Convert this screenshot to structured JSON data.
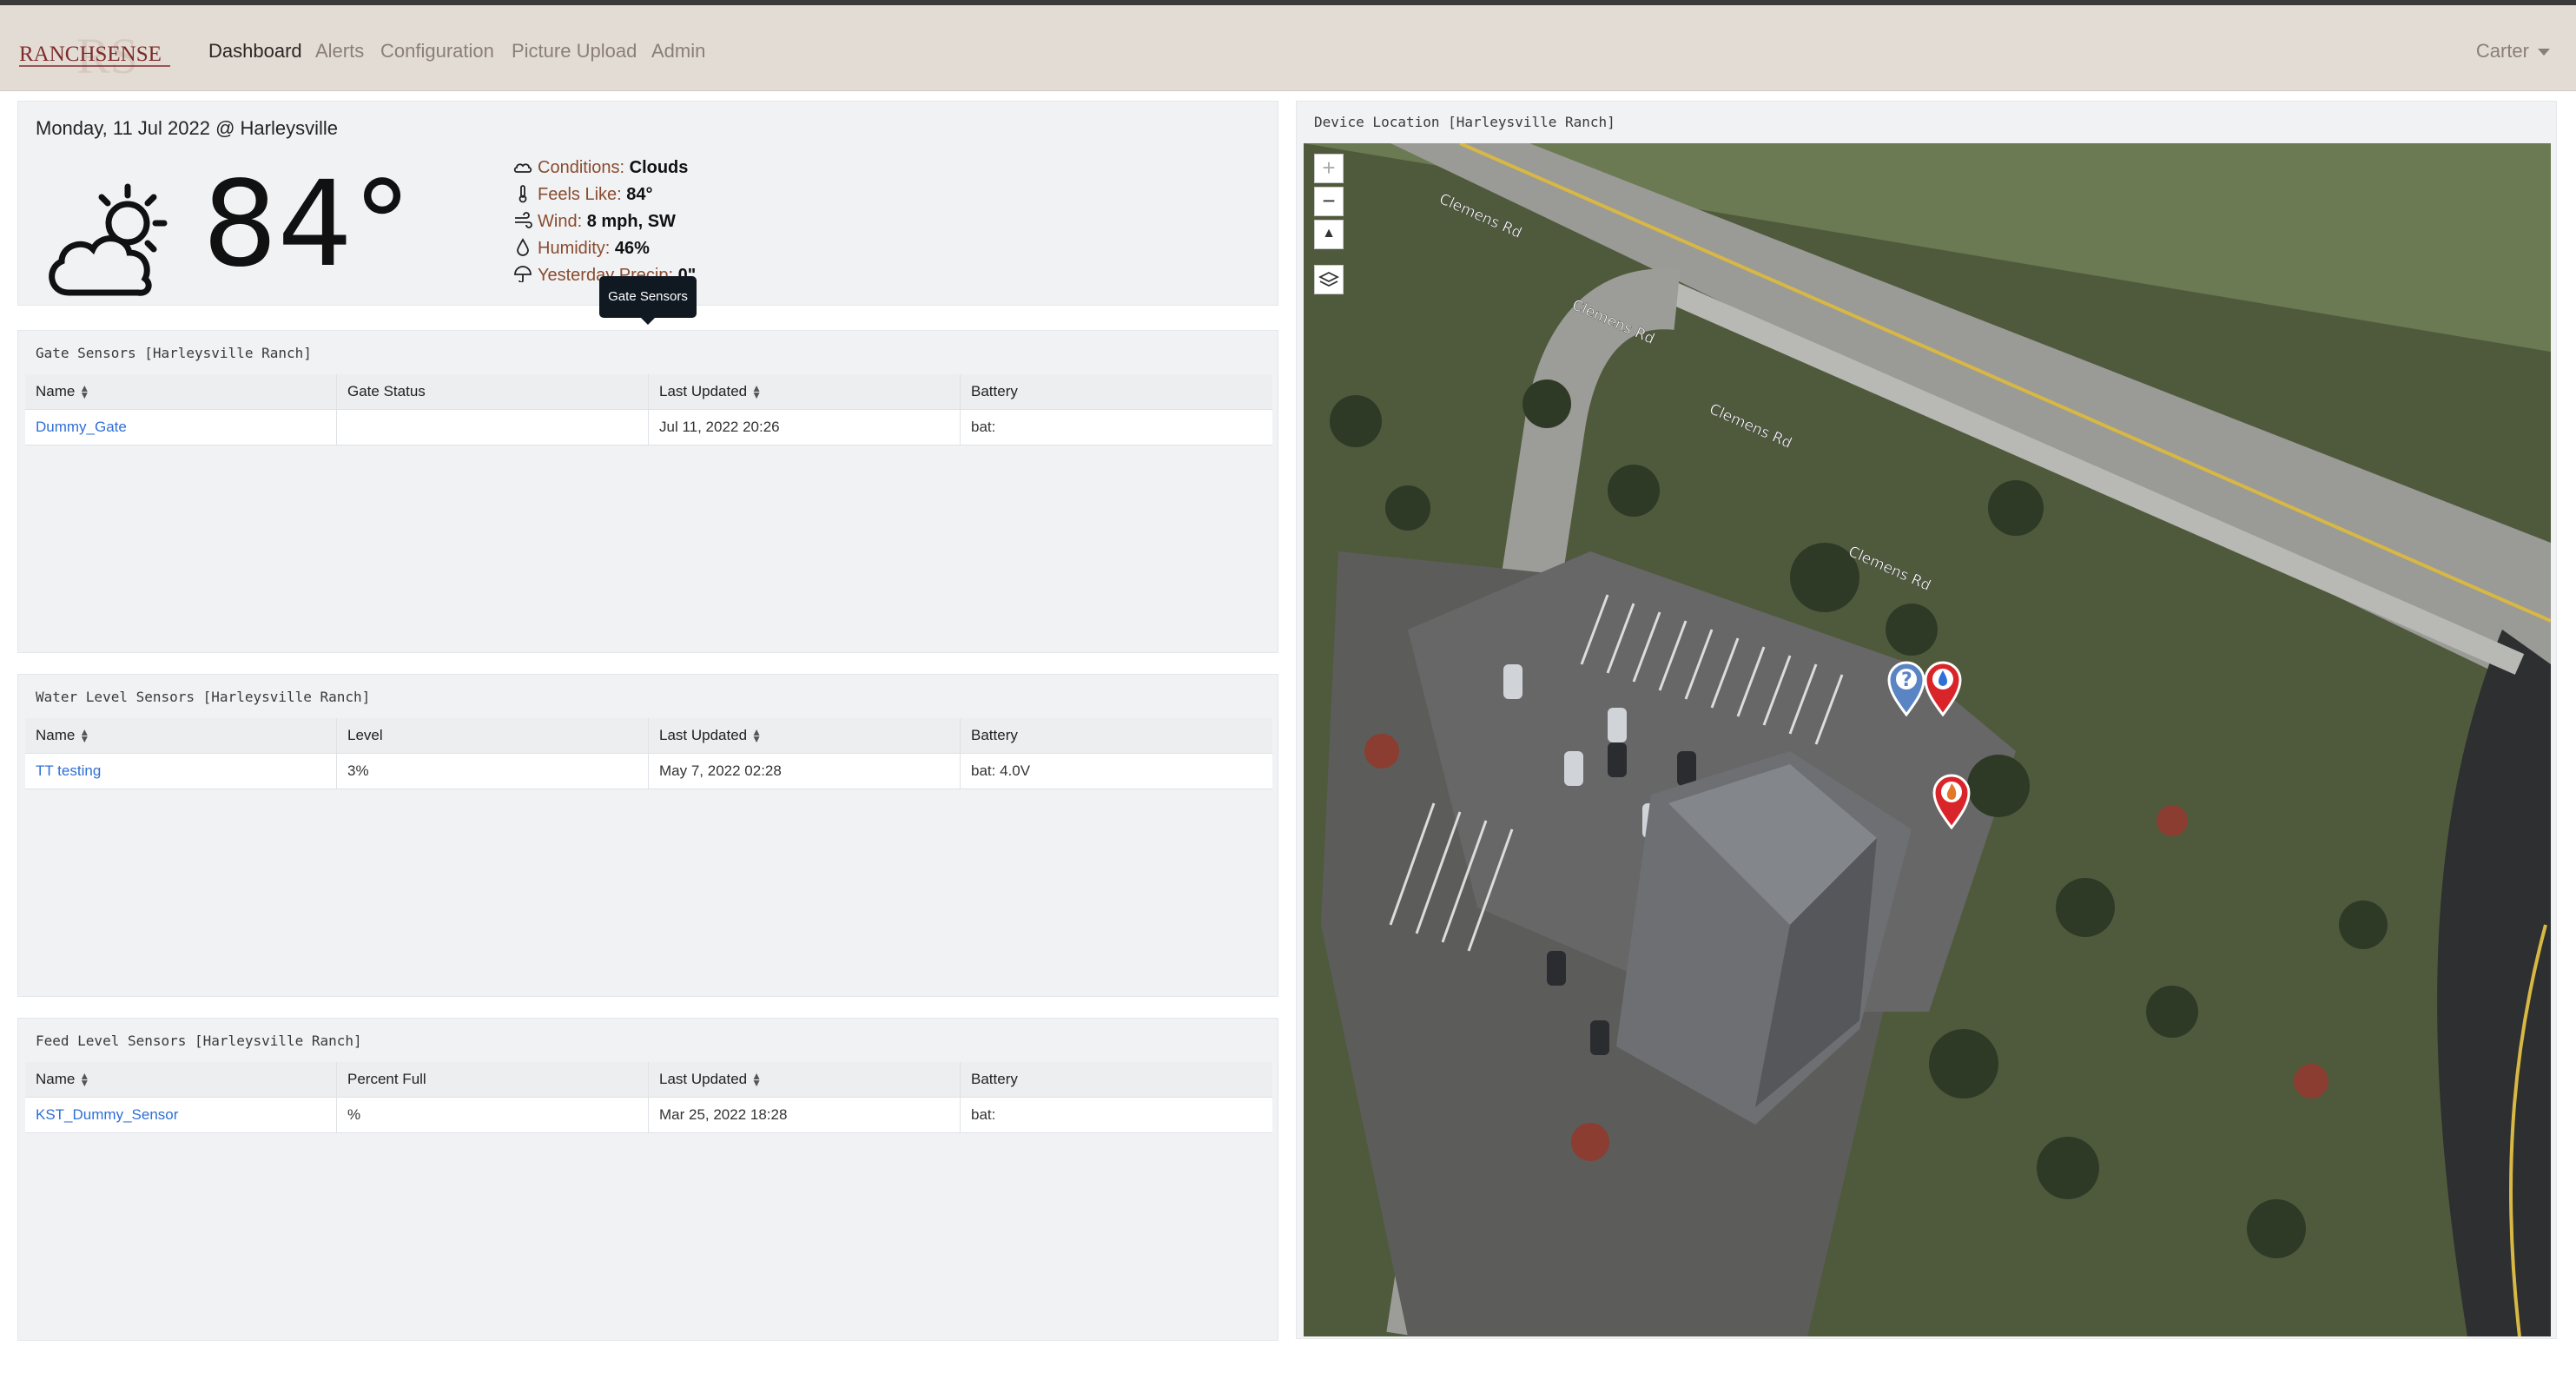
{
  "navbar": {
    "logo_text": "RANCHSENSE",
    "logo_monogram": "RS",
    "items": [
      {
        "label": "Dashboard",
        "active": true
      },
      {
        "label": "Alerts",
        "active": false
      },
      {
        "label": "Configuration",
        "active": false
      },
      {
        "label": "Picture Upload",
        "active": false
      },
      {
        "label": "Admin",
        "active": false
      }
    ],
    "user": "Carter",
    "colors": {
      "bar": "#e3dcd5",
      "active": "#2b2622",
      "inactive": "#8a7f78"
    }
  },
  "weather": {
    "date_location": "Monday, 11 Jul 2022 @ Harleysville",
    "icon": "partly-cloudy-sun-icon",
    "temperature": "84°",
    "rows": [
      {
        "icon": "cloud-icon",
        "label": "Conditions:",
        "value": "Clouds"
      },
      {
        "icon": "thermometer-icon",
        "label": "Feels Like:",
        "value": "84°"
      },
      {
        "icon": "wind-icon",
        "label": "Wind:",
        "value": "8 mph, SW"
      },
      {
        "icon": "droplet-icon",
        "label": "Humidity:",
        "value": "46%"
      },
      {
        "icon": "umbrella-icon",
        "label": "Yesterday Precip:",
        "value": "0\""
      }
    ],
    "tooltip": "Gate Sensors"
  },
  "gate_sensors": {
    "title": "Gate Sensors [Harleysville Ranch]",
    "headers": [
      "Name",
      "Gate Status",
      "Last Updated",
      "Battery"
    ],
    "rows": [
      {
        "name": "Dummy_Gate",
        "status": "",
        "updated": "Jul 11, 2022 20:26",
        "battery": "bat:"
      }
    ]
  },
  "water_sensors": {
    "title": "Water Level Sensors [Harleysville Ranch]",
    "headers": [
      "Name",
      "Level",
      "Last Updated",
      "Battery"
    ],
    "rows": [
      {
        "name": "TT testing",
        "status": "3%",
        "updated": "May 7, 2022 02:28",
        "battery": "bat: 4.0V"
      }
    ]
  },
  "feed_sensors": {
    "title": "Feed Level Sensors [Harleysville Ranch]",
    "headers": [
      "Name",
      "Percent Full",
      "Last Updated",
      "Battery"
    ],
    "rows": [
      {
        "name": "KST_Dummy_Sensor",
        "status": "%",
        "updated": "Mar 25, 2022 18:28",
        "battery": "bat:"
      }
    ]
  },
  "map": {
    "title": "Device Location [Harleysville Ranch]",
    "controls": [
      {
        "icon": "zoom-in-icon",
        "label": "+"
      },
      {
        "icon": "zoom-out-icon",
        "label": "−"
      },
      {
        "icon": "compass-icon",
        "label": "▲"
      },
      {
        "icon": "layers-icon",
        "label": ""
      }
    ],
    "road_labels": [
      "Clemens Rd",
      "Clemens Rd",
      "Clemens Rd",
      "Clemens Rd"
    ],
    "markers": [
      {
        "icon": "question-marker-icon",
        "color": "#5b84c4",
        "symbol": "?"
      },
      {
        "icon": "water-marker-icon",
        "color": "#d9252a",
        "symbol": "drop"
      },
      {
        "icon": "feed-marker-icon",
        "color": "#d9252a",
        "symbol": "flame"
      }
    ]
  }
}
